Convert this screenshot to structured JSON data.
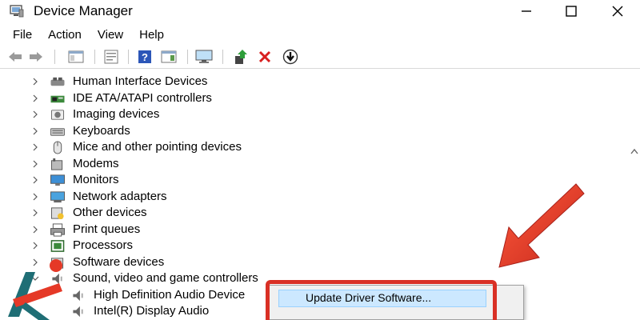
{
  "window": {
    "title": "Device Manager",
    "minimize_icon": "minimize-icon",
    "maximize_icon": "maximize-icon",
    "close_icon": "close-icon"
  },
  "menubar": {
    "items": [
      {
        "label": "File"
      },
      {
        "label": "Action"
      },
      {
        "label": "View"
      },
      {
        "label": "Help"
      }
    ]
  },
  "toolbar": {
    "buttons": [
      {
        "icon": "back-arrow-icon"
      },
      {
        "icon": "forward-arrow-icon"
      },
      {
        "icon": "show-hide-console-tree-icon"
      },
      {
        "icon": "properties-icon"
      },
      {
        "icon": "help-icon"
      },
      {
        "icon": "action-pane-icon"
      },
      {
        "icon": "monitor-icon"
      },
      {
        "icon": "update-driver-icon"
      },
      {
        "icon": "uninstall-x-icon"
      },
      {
        "icon": "scan-hardware-icon"
      }
    ]
  },
  "tree": {
    "nodes": [
      {
        "label": "Human Interface Devices",
        "icon": "hid-icon"
      },
      {
        "label": "IDE ATA/ATAPI controllers",
        "icon": "ide-controller-icon"
      },
      {
        "label": "Imaging devices",
        "icon": "camera-icon"
      },
      {
        "label": "Keyboards",
        "icon": "keyboard-icon"
      },
      {
        "label": "Mice and other pointing devices",
        "icon": "mouse-icon"
      },
      {
        "label": "Modems",
        "icon": "modem-icon"
      },
      {
        "label": "Monitors",
        "icon": "monitor-icon"
      },
      {
        "label": "Network adapters",
        "icon": "network-adapter-icon"
      },
      {
        "label": "Other devices",
        "icon": "unknown-device-icon"
      },
      {
        "label": "Print queues",
        "icon": "printer-icon"
      },
      {
        "label": "Processors",
        "icon": "processor-icon"
      },
      {
        "label": "Software devices",
        "icon": "software-device-icon"
      },
      {
        "label": "Sound, video and game controllers",
        "icon": "speaker-icon",
        "expanded": true
      },
      {
        "label": "High Definition Audio Device",
        "icon": "speaker-icon",
        "child": true,
        "selected": true
      },
      {
        "label": "Intel(R) Display Audio",
        "icon": "speaker-icon",
        "child": true
      }
    ]
  },
  "context_menu": {
    "items": [
      {
        "label": "Update Driver Software..."
      }
    ]
  },
  "colors": {
    "highlight_red": "#d93025",
    "selection_blue": "#cce8ff",
    "arrow_red": "#e53927"
  }
}
